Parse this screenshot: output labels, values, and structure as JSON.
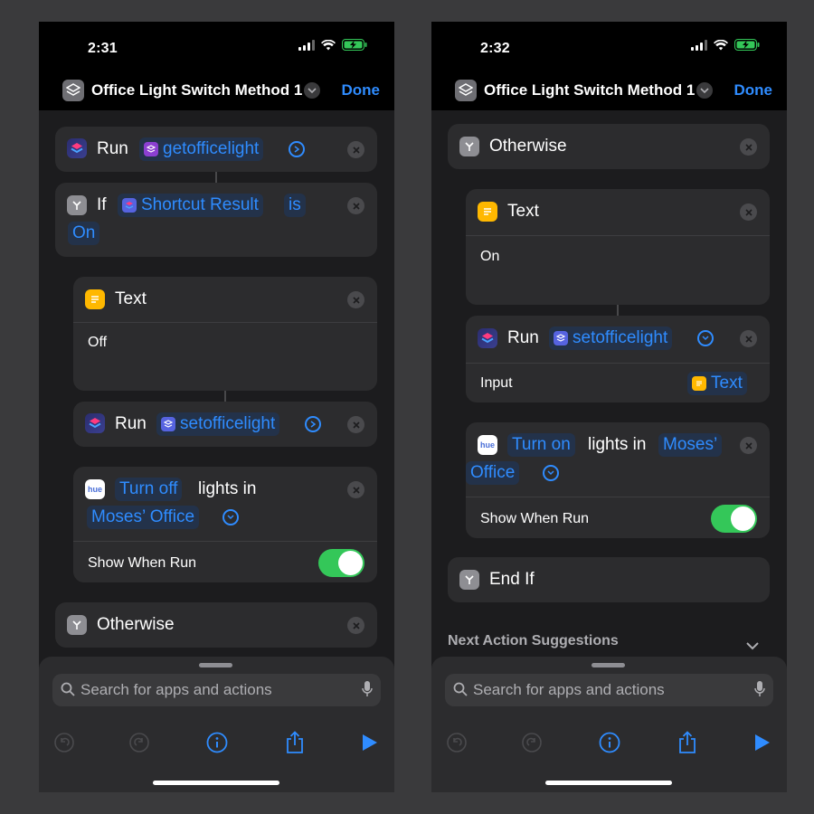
{
  "left": {
    "status": {
      "time": "2:31"
    },
    "nav": {
      "title": "Office Light Switch Method 1",
      "done_label": "Done"
    },
    "run1": {
      "run_label": "Run",
      "shortcut": "getofficelight"
    },
    "if_block": {
      "if_label": "If",
      "variable": "Shortcut Result",
      "operator": "is",
      "value": "On"
    },
    "text_block": {
      "title": "Text",
      "content": "Off"
    },
    "run2": {
      "run_label": "Run",
      "shortcut": "setofficelight"
    },
    "hue": {
      "action": "Turn off",
      "connector": "lights in",
      "room": "Moses’ Office",
      "show_when_run": "Show When Run",
      "toggle_on": true
    },
    "otherwise": {
      "label": "Otherwise"
    }
  },
  "right": {
    "status": {
      "time": "2:32"
    },
    "nav": {
      "title": "Office Light Switch Method 1",
      "done_label": "Done"
    },
    "otherwise": {
      "label": "Otherwise"
    },
    "text_block": {
      "title": "Text",
      "content": "On"
    },
    "run": {
      "run_label": "Run",
      "shortcut": "setofficelight",
      "input_label": "Input",
      "input_value": "Text"
    },
    "hue": {
      "action": "Turn on",
      "connector": "lights in",
      "room_part1": "Moses’",
      "room_part2": "Office",
      "show_when_run": "Show When Run",
      "toggle_on": true
    },
    "end_if": {
      "label": "End If"
    },
    "suggestions": {
      "label": "Next Action Suggestions"
    }
  },
  "search": {
    "placeholder": "Search for apps and actions"
  },
  "colors": {
    "accent": "#2f8cff",
    "toggle_green": "#34c759",
    "card": "#2c2c2e",
    "editor_bg": "#1c1c1e",
    "token_bg": "#23324a"
  },
  "icons": [
    "signal-icon",
    "wifi-icon",
    "battery-charging-icon",
    "shortcuts-icon",
    "chevron-down-icon",
    "close-icon",
    "conditional-icon",
    "text-icon",
    "hue-icon",
    "search-icon",
    "microphone-icon",
    "undo-icon",
    "redo-icon",
    "info-icon",
    "share-icon",
    "play-icon"
  ]
}
